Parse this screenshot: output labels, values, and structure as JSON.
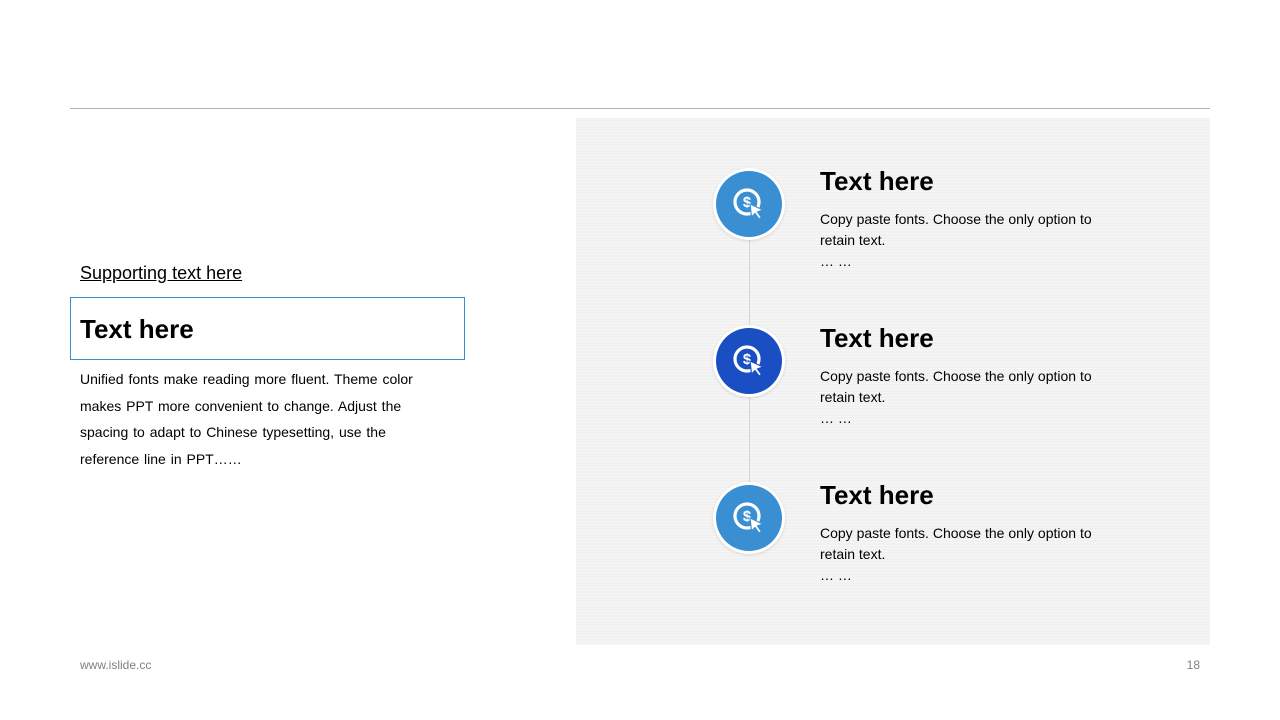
{
  "left": {
    "supporting": "Supporting text here",
    "title": "Text here",
    "body": "Unified fonts make reading more fluent. Theme color makes PPT more convenient to change. Adjust the spacing to adapt to Chinese typesetting, use the reference line in PPT……"
  },
  "items": [
    {
      "title": "Text here",
      "desc": "Copy paste fonts. Choose the only option to retain text.",
      "ellipsis": "… …",
      "icon": "dollar-click-icon",
      "color": "#3a8fd3"
    },
    {
      "title": "Text here",
      "desc": "Copy paste fonts. Choose the only option to retain text.",
      "ellipsis": "… …",
      "icon": "dollar-click-icon",
      "color": "#1a4fc4"
    },
    {
      "title": "Text here",
      "desc": "Copy paste fonts. Choose the only option to retain text.",
      "ellipsis": "… …",
      "icon": "dollar-click-icon",
      "color": "#3a8fd3"
    }
  ],
  "footer": {
    "url": "www.islide.cc",
    "page": "18"
  }
}
